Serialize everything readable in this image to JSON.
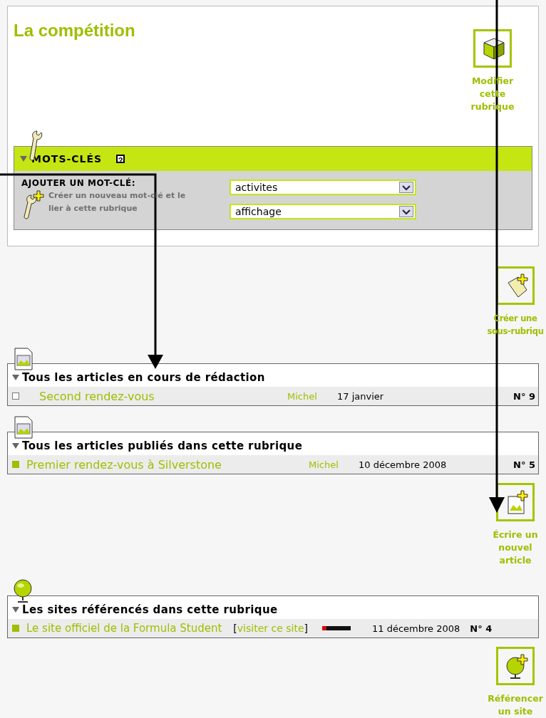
{
  "section": {
    "title": "La compétition",
    "action": {
      "label_lines": [
        "Modifier",
        "cette",
        "rubrique"
      ]
    }
  },
  "keywords": {
    "title": "MOTS-CLÉS",
    "help": "?",
    "expanded": true,
    "add_label": "AJOUTER UN MOT-CLÉ:",
    "create_label": "Créer un nouveau mot-clé et le lier à cette rubrique",
    "selects": [
      {
        "value": "activites"
      },
      {
        "value": "affichage"
      }
    ]
  },
  "subsection_action": {
    "label_lines": [
      "Créer une",
      "sous-rubriqu"
    ]
  },
  "article_lists": [
    {
      "title": "Tous les articles en cours de rédaction",
      "expanded": true,
      "rows": [
        {
          "published": false,
          "title": "Second rendez-vous",
          "author": "Michel",
          "date": "17 janvier",
          "number": "N° 9"
        }
      ]
    },
    {
      "title": "Tous les articles publiés dans cette rubrique",
      "expanded": true,
      "rows": [
        {
          "published": true,
          "title": "Premier rendez-vous à Silverstone",
          "author": "Michel",
          "date": "10 décembre 2008",
          "number": "N° 5"
        }
      ]
    }
  ],
  "article_action": {
    "label_lines": [
      "Écrire un",
      "nouvel",
      "article"
    ]
  },
  "sites": {
    "title": "Les sites référencés dans cette rubrique",
    "expanded": true,
    "rows": [
      {
        "published": true,
        "title": "Le site officiel de la Formula Student",
        "bracket_open": "[",
        "visit_link": "visiter ce site",
        "bracket_close": "]",
        "popularity": {
          "level": 0.15
        },
        "date": "11 décembre 2008",
        "number": "N° 4"
      }
    ]
  },
  "site_action": {
    "label_lines": [
      "Référencer",
      "un site"
    ]
  }
}
